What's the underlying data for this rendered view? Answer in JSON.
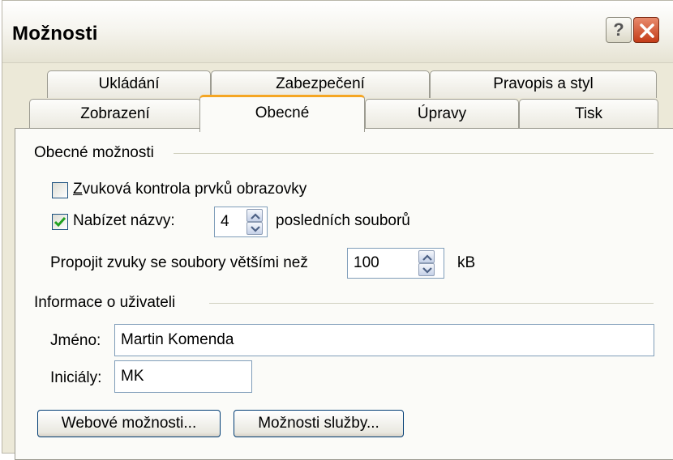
{
  "window": {
    "title": "Možnosti"
  },
  "tabs_row1": [
    {
      "label": "Ukládání"
    },
    {
      "label": "Zabezpečení"
    },
    {
      "label": "Pravopis a styl"
    }
  ],
  "tabs_row2": [
    {
      "label": "Zobrazení"
    },
    {
      "label": "Obecné"
    },
    {
      "label": "Úpravy"
    },
    {
      "label": "Tisk"
    }
  ],
  "general": {
    "group_label": "Obecné možnosti",
    "sound_check": {
      "label": "Zvuková kontrola prvků obrazovky",
      "checked": false
    },
    "recent_files": {
      "label": "Nabízet názvy:",
      "value": "4",
      "suffix": "posledních souborů",
      "checked": true
    },
    "link_sounds": {
      "label": "Propojit zvuky se soubory většími než",
      "value": "100",
      "unit": "kB"
    }
  },
  "user_info": {
    "group_label": "Informace o uživateli",
    "name_label": "Jméno:",
    "name_value": "Martin Komenda",
    "initials_label": "Iniciály:",
    "initials_value": "MK"
  },
  "buttons": {
    "web_options": "Webové možnosti...",
    "service_options": "Možnosti služby..."
  },
  "colors": {
    "active_tab_accent": "#f5a623",
    "dialog_bg": "#ece9d8",
    "close_button": "#c43c18"
  }
}
